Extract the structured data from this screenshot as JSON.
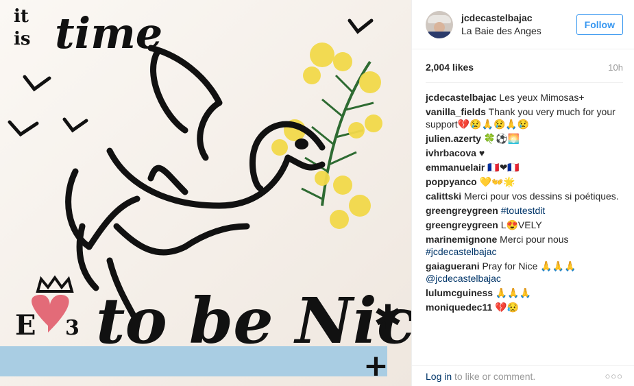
{
  "photo": {
    "handwriting": {
      "it": "it",
      "is": "is",
      "time": "time",
      "to_be_nice": "to be Nice",
      "star": "✱",
      "plus": "+",
      "e_char": "E",
      "three_char": "3"
    }
  },
  "header": {
    "username": "jcdecastelbajac",
    "location": "La Baie des Anges",
    "follow_label": "Follow"
  },
  "stats": {
    "likes": "2,004 likes",
    "time": "10h"
  },
  "comments": [
    {
      "user": "jcdecastelbajac",
      "text": "Les yeux Mimosas+"
    },
    {
      "user": "vanilla_fields",
      "text": "Thank you very much for your support💔😢🙏😢🙏😢"
    },
    {
      "user": "julien.azerty",
      "text": "🍀⚽🌅"
    },
    {
      "user": "ivhrbacova",
      "text": "♥"
    },
    {
      "user": "emmanuelair",
      "text": "🇫🇷❤🇫🇷"
    },
    {
      "user": "poppyanco",
      "text": "💛👐🌟"
    },
    {
      "user": "calittski",
      "text": "Merci pour vos dessins si poétiques."
    },
    {
      "user": "greengreygreen",
      "text": "",
      "tag": "#toutestdit"
    },
    {
      "user": "greengreygreen",
      "text": "L😍VELY"
    },
    {
      "user": "marinemignone",
      "text": "Merci pour nous ",
      "tag": "#jcdecastelbajac"
    },
    {
      "user": "gaiaguerani",
      "text": "Pray for Nice 🙏🙏🙏 ",
      "tag": "@jcdecastelbajac"
    },
    {
      "user": "lulumcguiness",
      "text": "🙏🙏🙏"
    },
    {
      "user": "moniquedec11",
      "text": "💔😥"
    }
  ],
  "footer": {
    "login_label": "Log in",
    "rest_text": " to like or comment.",
    "more_icon": "more-options-icon"
  }
}
